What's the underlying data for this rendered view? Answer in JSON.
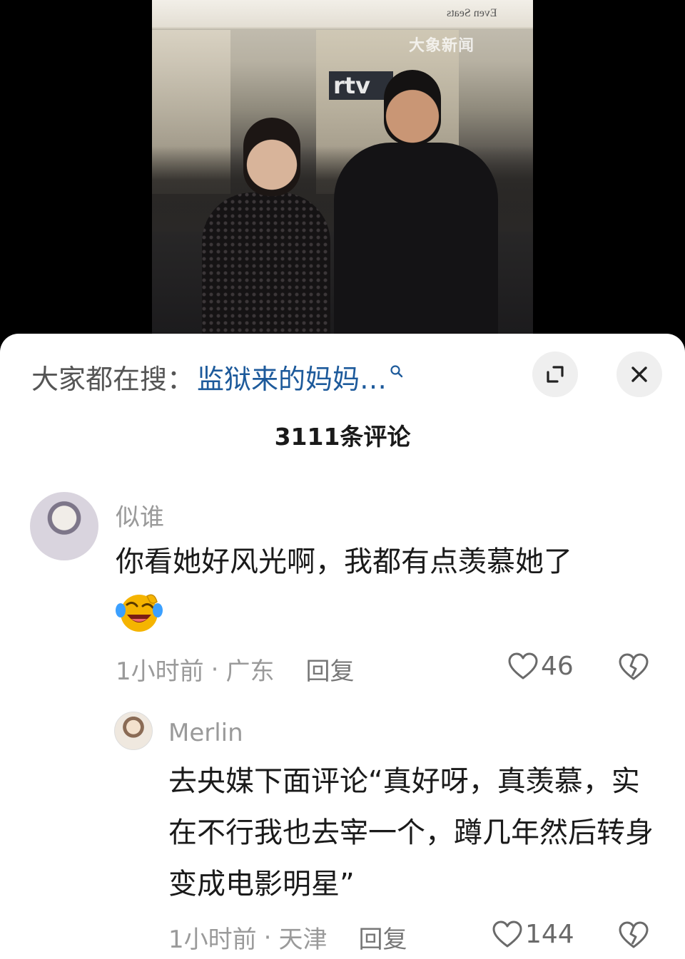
{
  "video": {
    "banner_text": "Even Seats",
    "watermark": "大象新闻",
    "sign_text": "rtv"
  },
  "search": {
    "prefix": "大家都在搜：",
    "query": "监狱来的妈妈…"
  },
  "comments_header": {
    "count_label": "3111条评论"
  },
  "comments": [
    {
      "username": "似谁",
      "text": "你看她好风光啊，我都有点羡慕她了",
      "emoji": "laughing-crying-emoji",
      "time": "1小时前",
      "location": "广东",
      "reply_label": "回复",
      "likes": "46"
    },
    {
      "username": "Merlin",
      "text": "去央媒下面评论“真好呀，真羡慕，实在不行我也去宰一个，蹲几年然后转身变成电影明星”",
      "time": "1小时前",
      "location": "天津",
      "reply_label": "回复",
      "likes": "144"
    }
  ],
  "colors": {
    "link_blue": "#1d5a9b",
    "meta_gray": "#9a9a9a",
    "text_dark": "#1a1a1a"
  }
}
